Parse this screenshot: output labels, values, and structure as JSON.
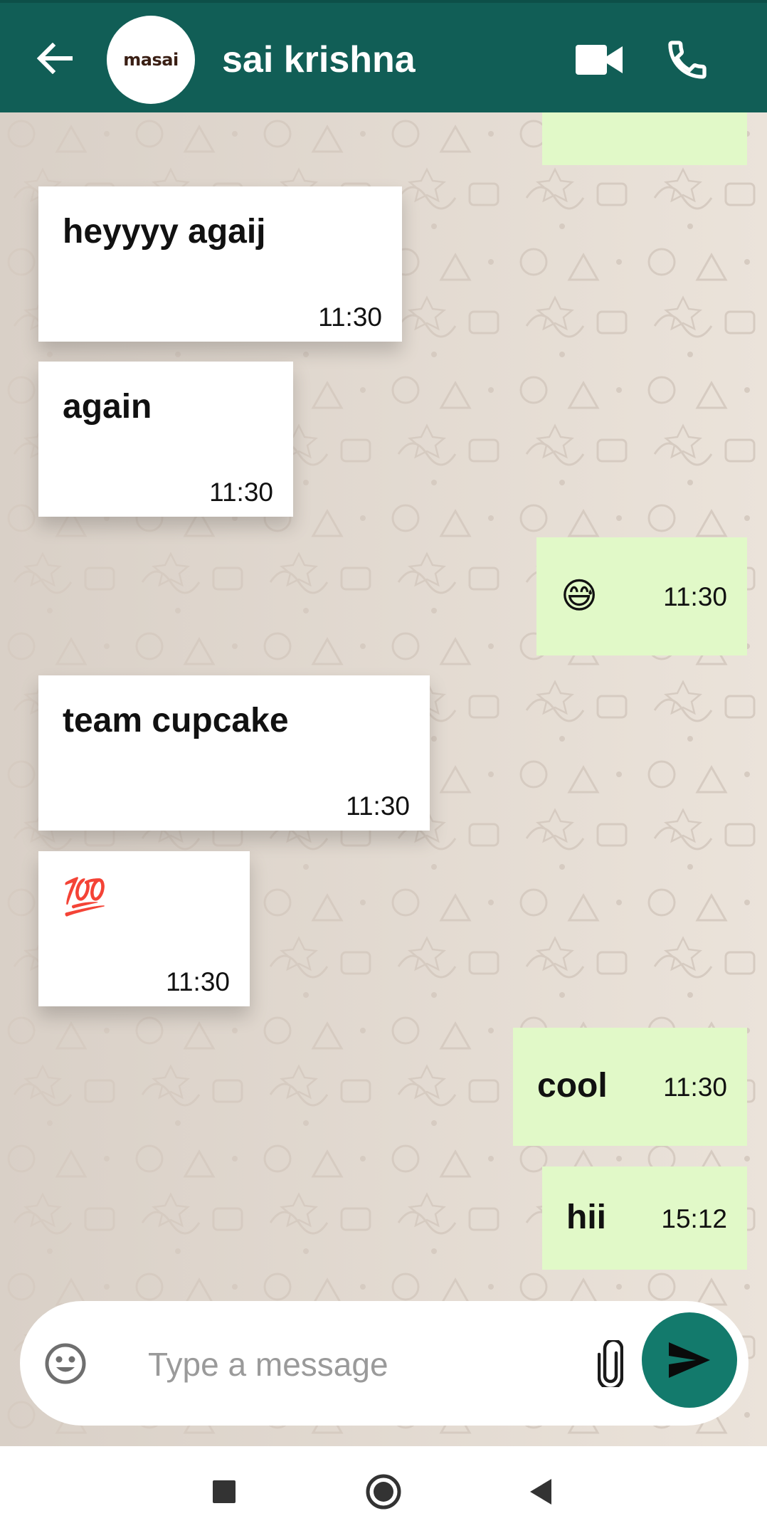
{
  "header": {
    "avatar_text": "masai",
    "contact_name": "sai krishna"
  },
  "messages": [
    {
      "direction": "outgoing",
      "text": "",
      "time": ""
    },
    {
      "direction": "incoming",
      "text": "heyyyy agaij",
      "time": "11:30"
    },
    {
      "direction": "incoming",
      "text": "again",
      "time": "11:30"
    },
    {
      "direction": "outgoing",
      "text": "😅",
      "time": "11:30"
    },
    {
      "direction": "incoming",
      "text": "team cupcake",
      "time": "11:30"
    },
    {
      "direction": "incoming",
      "text": "💯",
      "time": "11:30"
    },
    {
      "direction": "outgoing",
      "text": "cool",
      "time": "11:30"
    },
    {
      "direction": "outgoing",
      "text": "hii",
      "time": "15:12"
    }
  ],
  "composer": {
    "placeholder": "Type a message",
    "value": ""
  },
  "icons": {
    "back": "arrow-left-icon",
    "video": "video-camera-icon",
    "call": "phone-icon",
    "emoji": "smiley-icon",
    "attach": "paperclip-icon",
    "send": "send-icon",
    "nav_recents": "square-icon",
    "nav_home": "circle-icon",
    "nav_back": "triangle-back-icon"
  },
  "colors": {
    "header": "#115e56",
    "chat_background": "#e7ddd4",
    "incoming_bubble": "#ffffff",
    "outgoing_bubble": "#e1f9c8",
    "send_button": "#137a6c"
  }
}
